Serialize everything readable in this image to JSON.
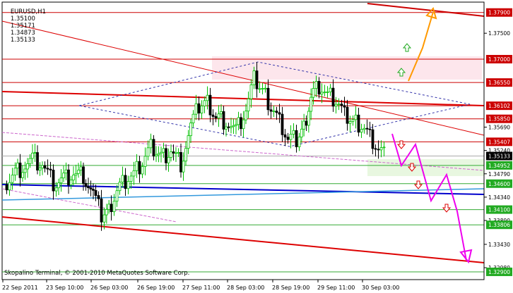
{
  "header": {
    "symbol": "EURUSD,H1",
    "open": "1.35100",
    "high": "1.35171",
    "low": "1.34873",
    "close": "1.35133"
  },
  "footer": {
    "copyright": "Skopalino Terminal, © 2001-2010 MetaQuotes Software Corp."
  },
  "colors": {
    "background": "#ffffff",
    "candle_up": "#00c000",
    "candle_down": "#000000",
    "level_line": "#cc0000",
    "support_fill": "#e8f7e0",
    "resistance_fill": "#fde6ec",
    "trend_red": "#dd0000",
    "trend_blue": "#0000cc",
    "diamond": "#3333aa",
    "projection_up": "#ff9900",
    "projection_down": "#ee00ee"
  },
  "chart_data": {
    "type": "candlestick",
    "symbol": "EURUSD",
    "timeframe": "H1",
    "ylim": [
      1.3275,
      1.381
    ],
    "price_axis_ticks": [
      "1.37900",
      "1.37500",
      "1.37000",
      "1.36550",
      "1.36102",
      "1.35850",
      "1.35690",
      "1.35407",
      "1.35240",
      "1.35133",
      "1.34952",
      "1.34790",
      "1.34600",
      "1.34340",
      "1.34100",
      "1.33890",
      "1.33806",
      "1.33430",
      "1.32980",
      "1.32900"
    ],
    "highlighted_levels": [
      {
        "price": 1.379,
        "label": "1.37900"
      },
      {
        "price": 1.37,
        "label": "1.37000"
      },
      {
        "price": 1.3655,
        "label": "1.36550"
      },
      {
        "price": 1.36102,
        "label": "1.36102"
      },
      {
        "price": 1.3585,
        "label": "1.35850"
      },
      {
        "price": 1.35407,
        "label": "1.35407"
      },
      {
        "price": 1.35133,
        "label": "1.35133",
        "current": true
      },
      {
        "price": 1.34952,
        "label": "1.34952"
      },
      {
        "price": 1.346,
        "label": "1.34600"
      },
      {
        "price": 1.341,
        "label": "1.34100"
      },
      {
        "price": 1.33806,
        "label": "1.33806"
      },
      {
        "price": 1.329,
        "label": "1.32900"
      }
    ],
    "time_labels": [
      "22 Sep 2011",
      "23 Sep 10:00",
      "26 Sep 03:00",
      "26 Sep 19:00",
      "27 Sep 11:00",
      "28 Sep 03:00",
      "28 Sep 19:00",
      "29 Sep 11:00",
      "30 Sep 03:00"
    ]
  }
}
